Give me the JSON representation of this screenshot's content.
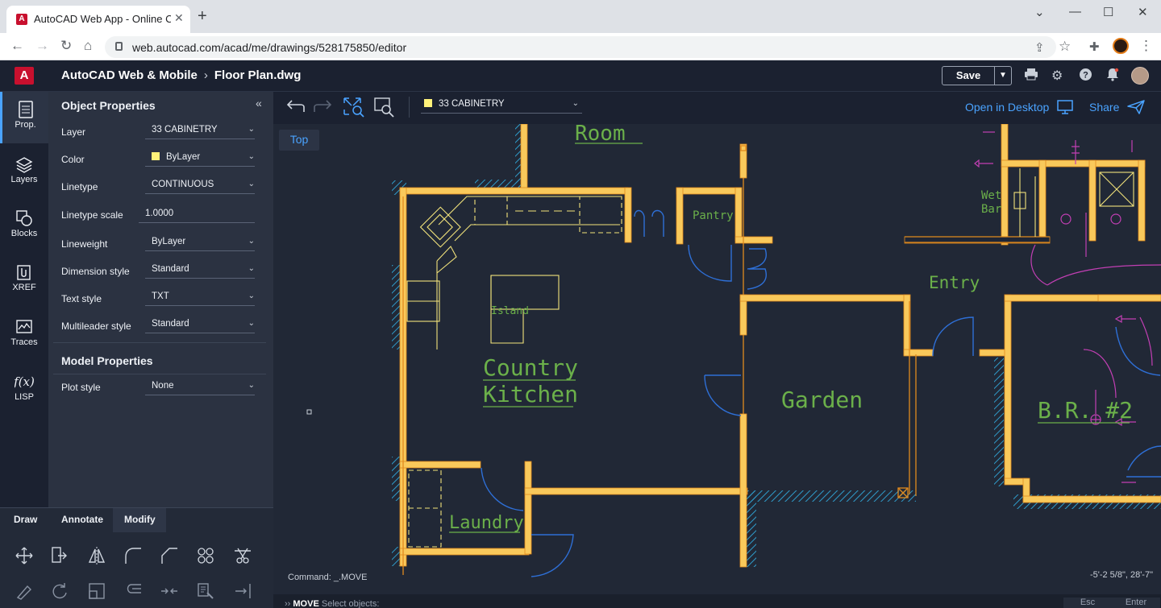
{
  "browser": {
    "tab_title": "AutoCAD Web App - Online CAD",
    "url": "web.autocad.com/acad/me/drawings/528175850/editor"
  },
  "app": {
    "product": "AutoCAD Web & Mobile",
    "file": "Floor Plan.dwg",
    "save_label": "Save"
  },
  "rail": [
    {
      "label": "Prop."
    },
    {
      "label": "Layers"
    },
    {
      "label": "Blocks"
    },
    {
      "label": "XREF"
    },
    {
      "label": "Traces"
    },
    {
      "label": "LISP"
    }
  ],
  "object_properties": {
    "title": "Object Properties",
    "rows": [
      {
        "label": "Layer",
        "value": "33 CABINETRY"
      },
      {
        "label": "Color",
        "value": "ByLayer"
      },
      {
        "label": "Linetype",
        "value": "CONTINUOUS"
      },
      {
        "label": "Linetype scale",
        "value": "1.0000"
      },
      {
        "label": "Lineweight",
        "value": "ByLayer"
      },
      {
        "label": "Dimension style",
        "value": "Standard"
      },
      {
        "label": "Text style",
        "value": "TXT"
      },
      {
        "label": "Multileader style",
        "value": "Standard"
      }
    ]
  },
  "model_properties": {
    "title": "Model Properties",
    "rows": [
      {
        "label": "Plot style",
        "value": "None"
      }
    ]
  },
  "toolset": {
    "tabs": [
      "Draw",
      "Annotate",
      "Modify"
    ],
    "active_tab": "Modify"
  },
  "canvas": {
    "layer": "33 CABINETRY",
    "layer_color": "#fff27a",
    "open_desktop": "Open in Desktop",
    "share": "Share",
    "view": "Top",
    "command_history": "Command: _.MOVE",
    "coordinates": "-5'-2 5/8\", 28'-7\"",
    "prompt_cmd": "MOVE",
    "prompt_text": "Select objects:",
    "esc": "Esc",
    "enter": "Enter"
  },
  "rooms": {
    "room": "Room",
    "pantry": "Pantry",
    "wet": "Wet",
    "bar": "Bar",
    "entry": "Entry",
    "island": "Island",
    "country": "Country",
    "kitchen": "Kitchen",
    "garden": "Garden",
    "br2": "B.R. #2",
    "laundry": "Laundry"
  },
  "colors": {
    "wall": "#f9c95b",
    "hatch": "#2f9bc9",
    "door": "#2e6fd6",
    "text": "#6bb04a",
    "electrical": "#c23fb4",
    "accent": "#4aa3ff"
  }
}
